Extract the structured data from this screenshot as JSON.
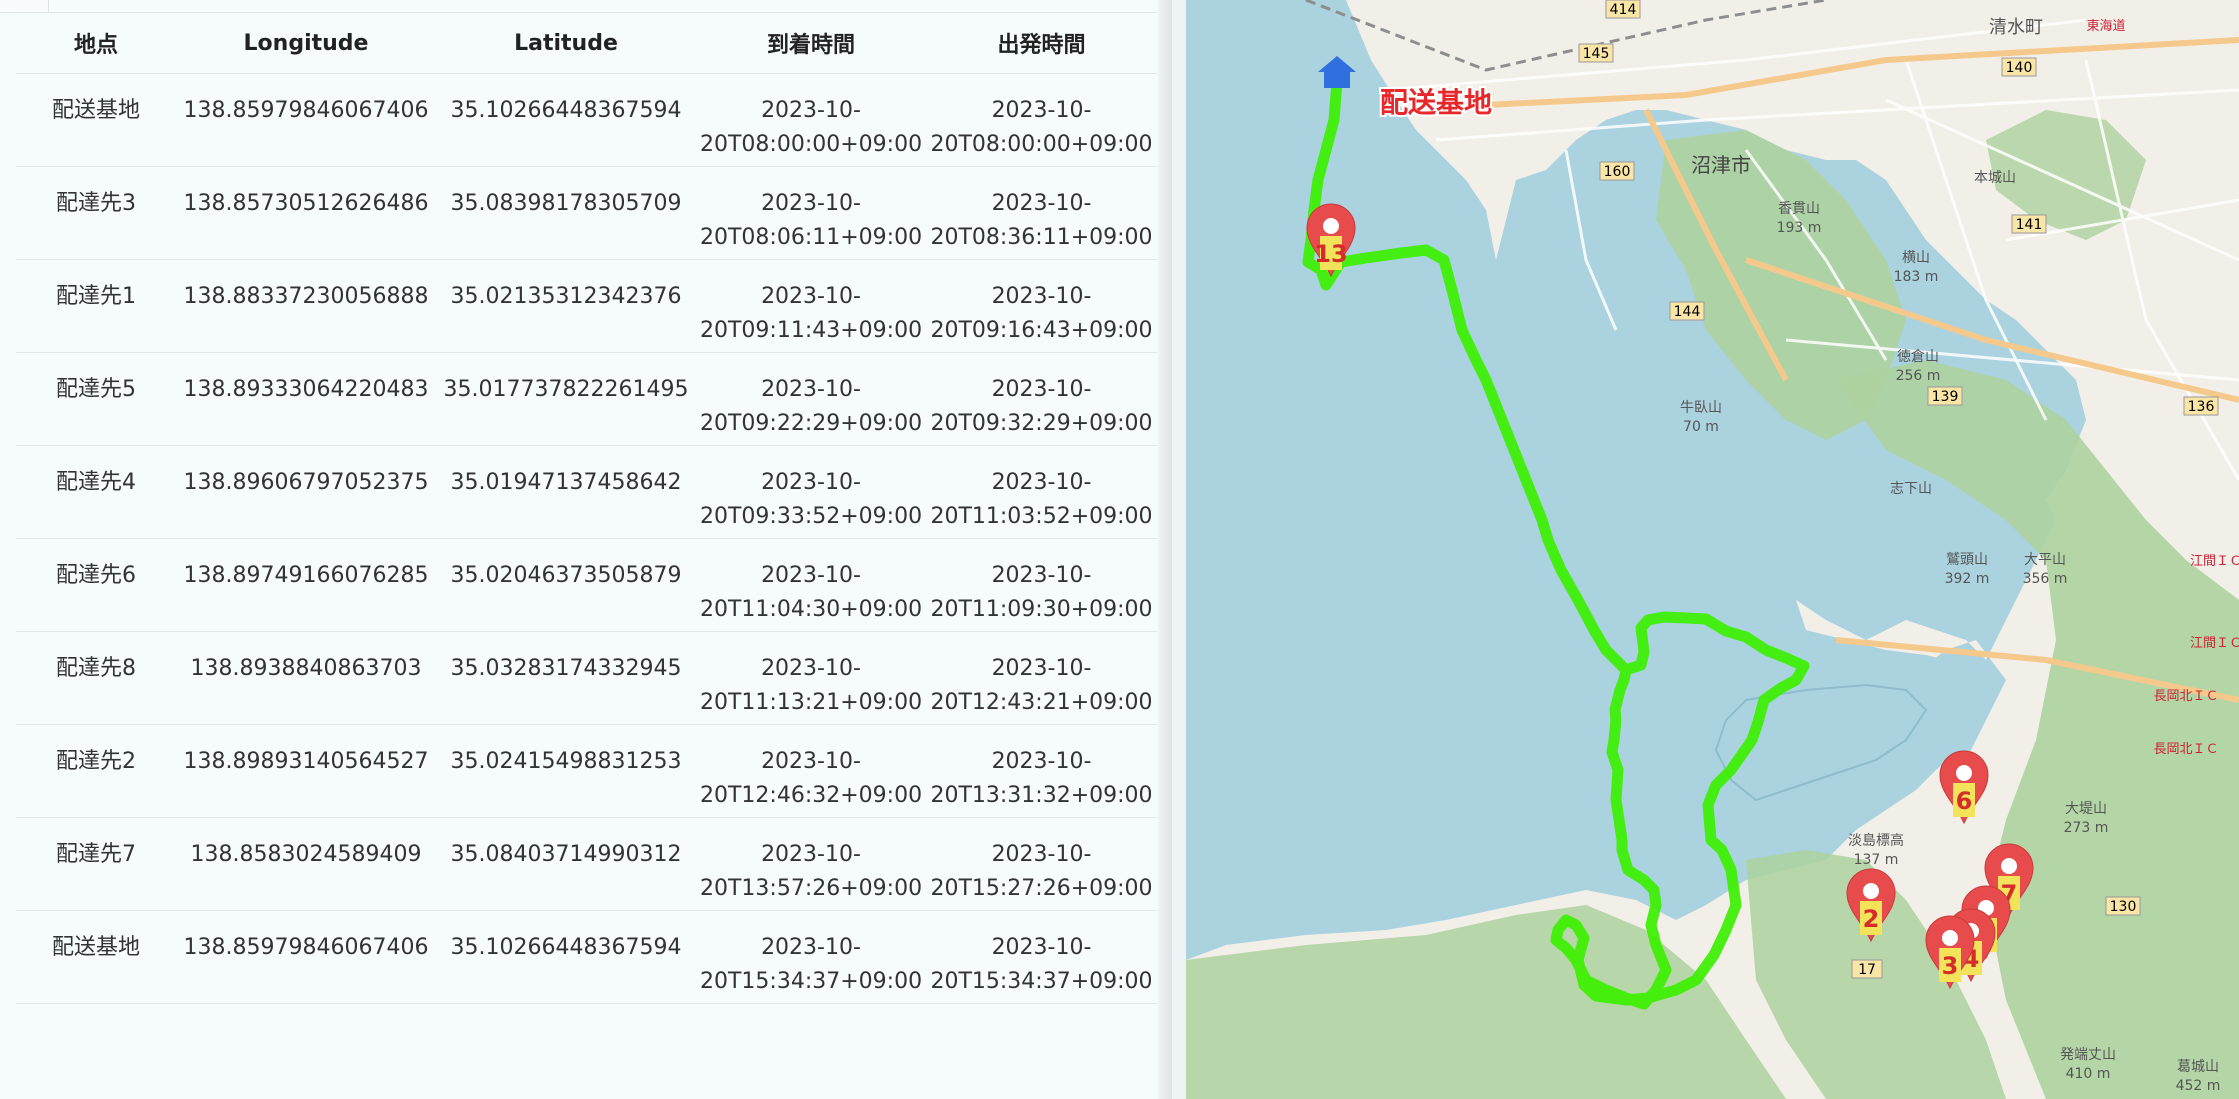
{
  "table": {
    "headers": [
      "地点",
      "Longitude",
      "Latitude",
      "到着時間",
      "出発時間"
    ],
    "rows": [
      {
        "place": "配送基地",
        "lon": "138.85979846067406",
        "lat": "35.10266448367594",
        "arrive_date": "2023-10-",
        "arrive_time": "20T08:00:00+09:00",
        "depart_date": "2023-10-",
        "depart_time": "20T08:00:00+09:00"
      },
      {
        "place": "配達先3",
        "lon": "138.85730512626486",
        "lat": "35.08398178305709",
        "arrive_date": "2023-10-",
        "arrive_time": "20T08:06:11+09:00",
        "depart_date": "2023-10-",
        "depart_time": "20T08:36:11+09:00"
      },
      {
        "place": "配達先1",
        "lon": "138.88337230056888",
        "lat": "35.02135312342376",
        "arrive_date": "2023-10-",
        "arrive_time": "20T09:11:43+09:00",
        "depart_date": "2023-10-",
        "depart_time": "20T09:16:43+09:00"
      },
      {
        "place": "配達先5",
        "lon": "138.89333064220483",
        "lat": "35.017737822261495",
        "arrive_date": "2023-10-",
        "arrive_time": "20T09:22:29+09:00",
        "depart_date": "2023-10-",
        "depart_time": "20T09:32:29+09:00"
      },
      {
        "place": "配達先4",
        "lon": "138.89606797052375",
        "lat": "35.01947137458642",
        "arrive_date": "2023-10-",
        "arrive_time": "20T09:33:52+09:00",
        "depart_date": "2023-10-",
        "depart_time": "20T11:03:52+09:00"
      },
      {
        "place": "配達先6",
        "lon": "138.89749166076285",
        "lat": "35.02046373505879",
        "arrive_date": "2023-10-",
        "arrive_time": "20T11:04:30+09:00",
        "depart_date": "2023-10-",
        "depart_time": "20T11:09:30+09:00"
      },
      {
        "place": "配達先8",
        "lon": "138.8938840863703",
        "lat": "35.03283174332945",
        "arrive_date": "2023-10-",
        "arrive_time": "20T11:13:21+09:00",
        "depart_date": "2023-10-",
        "depart_time": "20T12:43:21+09:00"
      },
      {
        "place": "配達先2",
        "lon": "138.89893140564527",
        "lat": "35.02415498831253",
        "arrive_date": "2023-10-",
        "arrive_time": "20T12:46:32+09:00",
        "depart_date": "2023-10-",
        "depart_time": "20T13:31:32+09:00"
      },
      {
        "place": "配達先7",
        "lon": "138.8583024589409",
        "lat": "35.08403714990312",
        "arrive_date": "2023-10-",
        "arrive_time": "20T13:57:26+09:00",
        "depart_date": "2023-10-",
        "depart_time": "20T15:27:26+09:00"
      },
      {
        "place": "配送基地",
        "lon": "138.85979846067406",
        "lat": "35.10266448367594",
        "arrive_date": "2023-10-",
        "arrive_time": "20T15:34:37+09:00",
        "depart_date": "2023-10-",
        "depart_time": "20T15:34:37+09:00"
      }
    ]
  },
  "map": {
    "base_label": "配送基地",
    "base_icon": "home-icon",
    "marker_labels": [
      "13",
      "6",
      "2",
      "7",
      "5",
      "4",
      "3"
    ],
    "route_color": "#3cf000",
    "marker_color": "#e84b4b",
    "marker_number_bg": "#f3e35a",
    "marker_number_color": "#d62b2b",
    "base_label_color": "#e8272b",
    "water_color": "#aad3df",
    "land_color": "#f2efe9",
    "forest_color": "#add19e",
    "place_labels": [
      {
        "text": "沼津市"
      },
      {
        "text": "清水町"
      },
      {
        "text": "香貫山"
      },
      {
        "text": "193 m"
      },
      {
        "text": "横山"
      },
      {
        "text": "183 m"
      },
      {
        "text": "徳倉山"
      },
      {
        "text": "256 m"
      },
      {
        "text": "牛臥山"
      },
      {
        "text": "70 m"
      },
      {
        "text": "志下山"
      },
      {
        "text": "鷲頭山"
      },
      {
        "text": "392 m"
      },
      {
        "text": "大平山"
      },
      {
        "text": "356 m"
      },
      {
        "text": "淡島標高"
      },
      {
        "text": "137 m"
      },
      {
        "text": "大堤山"
      },
      {
        "text": "273 m"
      },
      {
        "text": "発端丈山"
      },
      {
        "text": "410 m"
      },
      {
        "text": "葛城山"
      },
      {
        "text": "452 m"
      },
      {
        "text": "本城山"
      },
      {
        "text": "長岡北ＩＣ"
      },
      {
        "text": "長岡北ＩＣ"
      },
      {
        "text": "江間ＩＣ"
      },
      {
        "text": "江間ＩＣ"
      },
      {
        "text": "東海道"
      }
    ],
    "road_numbers": [
      "414",
      "145",
      "140",
      "160",
      "144",
      "141",
      "139",
      "136",
      "130",
      "17"
    ]
  }
}
